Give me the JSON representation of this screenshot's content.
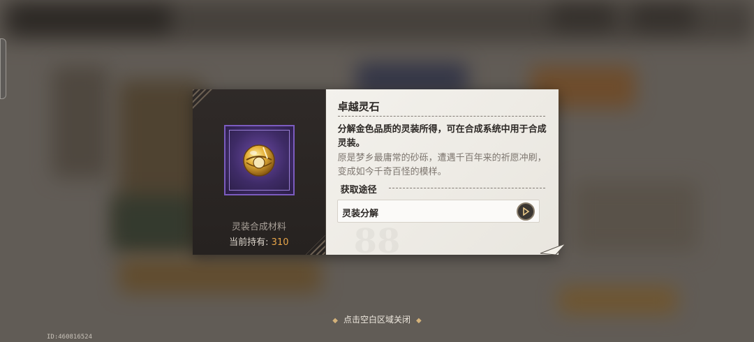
{
  "item": {
    "name": "卓越灵石",
    "icon": "gold-orb-icon",
    "rarity_color": "#7c5cc0",
    "category": "灵装合成材料",
    "holding_label": "当前持有:",
    "holding_count": "310",
    "description": "分解金色品质的灵装所得，可在合成系统中用于合成灵装。",
    "lore": "原是梦乡最庸常的砂砾，遭遇千百年来的祈愿冲刷，变成如今千奇百怪的模样。"
  },
  "source": {
    "heading": "获取途径",
    "items": [
      {
        "label": "灵装分解",
        "icon": "arrow-right-icon"
      }
    ]
  },
  "footer": {
    "close_hint": "点击空白区域关闭",
    "uid": "ID:460816524"
  },
  "colors": {
    "accent_gold": "#e8a64a",
    "rarity_purple": "#7c5cc0"
  }
}
